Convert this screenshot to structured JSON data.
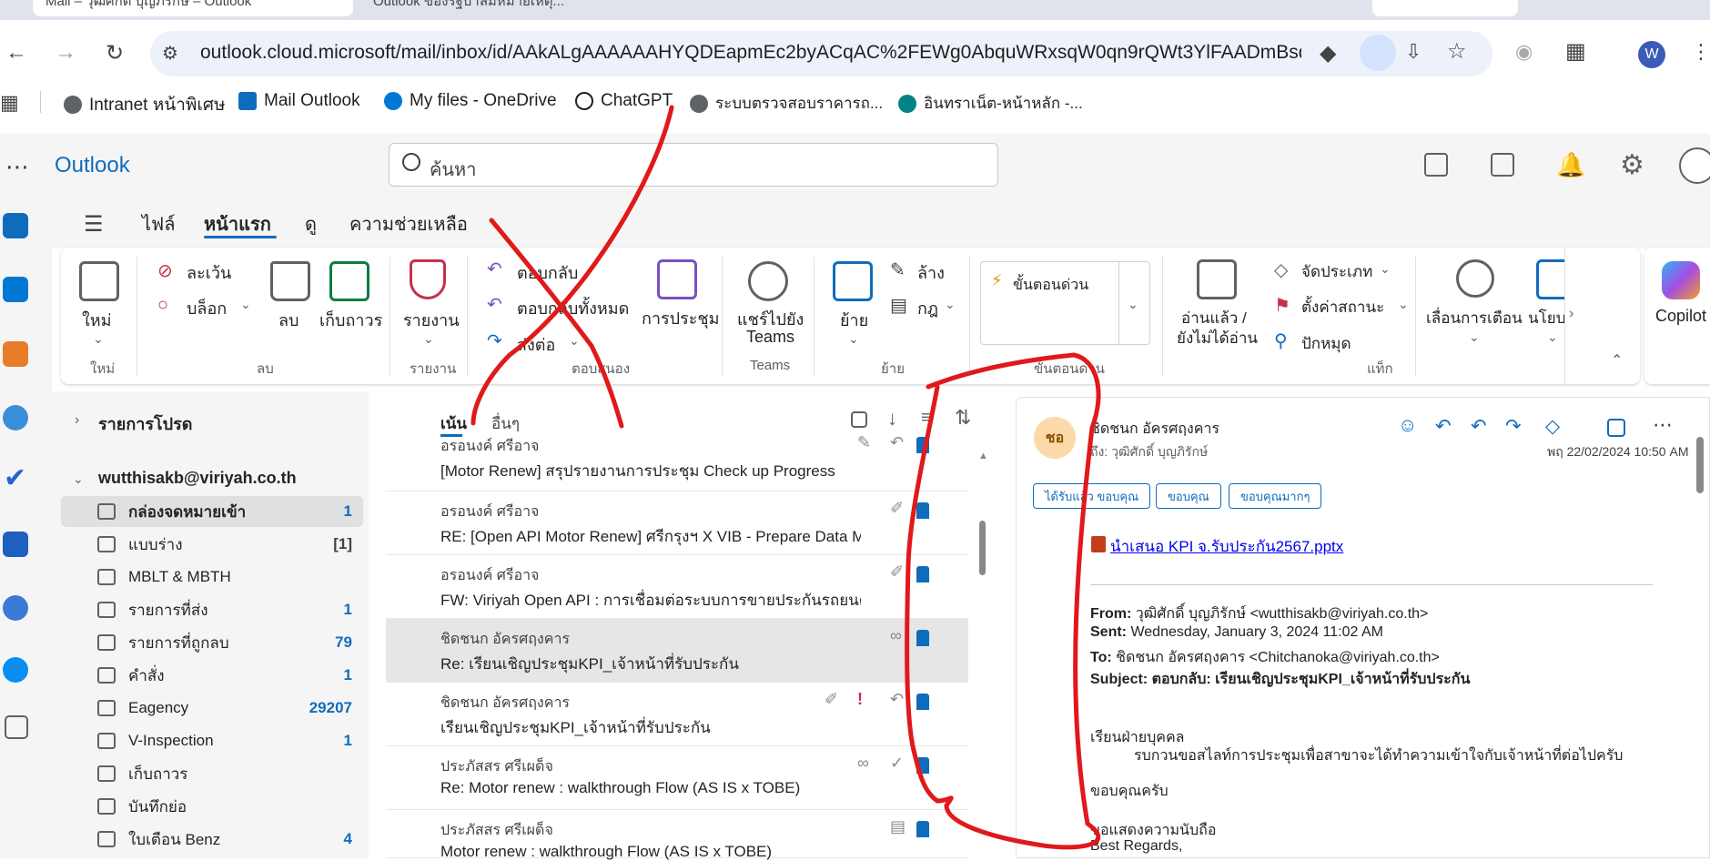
{
  "browser": {
    "tab1_title": "Mail – วุฒิศักดิ์ บุญภิรักษ์ – Outlook",
    "tab2_title": "Outlook ของรัฐบาลมีหมายเหตุ...",
    "url": "outlook.cloud.microsoft/mail/inbox/id/AAkALgAAAAAAHYQDEapmEc2byACqAC%2FEWg0AbquWRxsqW0qn9rQWt3YlFAADmBsq...",
    "profile_initial": "W",
    "bookmarks": [
      {
        "label": "Intranet หน้าพิเศษ",
        "color": "#5f6368"
      },
      {
        "label": "Mail Outlook",
        "color": "#0f6cbd"
      },
      {
        "label": "My files - OneDrive",
        "color": "#0078d4"
      },
      {
        "label": "ChatGPT",
        "color": "#1f1f1f"
      },
      {
        "label": "ระบบตรวจสอบราคารถ...",
        "color": "#5f6368"
      },
      {
        "label": "อินทราเน็ต-หน้าหลัก -...",
        "color": "#038387"
      }
    ]
  },
  "app": {
    "name": "Outlook",
    "search_placeholder": "ค้นหา"
  },
  "menu_tabs": [
    "ไฟล์",
    "หน้าแรก",
    "ดู",
    "ความช่วยเหลือ"
  ],
  "ribbon": {
    "new": "ใหม่",
    "new_group": "ใหม่",
    "ignore": "ละเว้น",
    "block": "บล็อก",
    "delete": "ลบ",
    "archive": "เก็บถาวร",
    "delete_group": "ลบ",
    "report": "รายงาน",
    "report_group": "รายงาน",
    "reply": "ตอบกลับ",
    "reply_all": "ตอบกลับทั้งหมด",
    "forward": "ส่งต่อ",
    "meeting": "การประชุม",
    "respond_group": "ตอบสนอง",
    "share_teams_1": "แชร์ไปยัง",
    "share_teams_2": "Teams",
    "teams_group": "Teams",
    "move": "ย้าย",
    "sweep": "ล้าง",
    "rules": "กฎ",
    "move_group": "ย้าย",
    "quick_steps": "ขั้นตอนด่วน",
    "quick_steps_group": "ขั้นตอนด่วน",
    "read_unread_1": "อ่านแล้ว /",
    "read_unread_2": "ยังไม่ได้อ่าน",
    "categorize": "จัดประเภท",
    "flag": "ตั้งค่าสถานะ",
    "pin": "ปักหมุด",
    "tags_group": "แท็ก",
    "snooze": "เลื่อนการเตือน",
    "policy": "นโยบ",
    "copilot": "Copilot"
  },
  "folders": {
    "favorites": "รายการโปรด",
    "account": "wutthisakb@viriyah.co.th",
    "items": [
      {
        "label": "กล่องจดหมายเข้า",
        "count": "1"
      },
      {
        "label": "แบบร่าง",
        "count": "[1]"
      },
      {
        "label": "MBLT & MBTH",
        "count": ""
      },
      {
        "label": "รายการที่ส่ง",
        "count": "1"
      },
      {
        "label": "รายการที่ถูกลบ",
        "count": "79"
      },
      {
        "label": "คำสั่ง",
        "count": "1"
      },
      {
        "label": "Eagency",
        "count": "29207"
      },
      {
        "label": "V-Inspection",
        "count": "1"
      },
      {
        "label": "เก็บถาวร",
        "count": ""
      },
      {
        "label": "บันทึกย่อ",
        "count": ""
      },
      {
        "label": "ใบเตือน Benz",
        "count": "4"
      }
    ]
  },
  "list": {
    "tab_focused": "เน้น",
    "tab_other": "อื่นๆ",
    "messages": [
      {
        "sender": "อรอนงค์ ศรีอาจ",
        "subject": "[Motor Renew] สรุปรายงานการประชุม Check up Progress"
      },
      {
        "sender": "อรอนงค์ ศรีอาจ",
        "subject": "RE: [Open API Motor Renew] ศรีกรุงฯ X VIB - Prepare Data M"
      },
      {
        "sender": "อรอนงค์ ศรีอาจ",
        "subject": "FW: Viriyah Open API : การเชื่อมต่อระบบการขายประกันรถยนต์ไฟ"
      },
      {
        "sender": "ชิดชนก อัครศฤงคาร",
        "subject": "Re: เรียนเชิญประชุมKPI_เจ้าหน้าที่รับประกัน"
      },
      {
        "sender": "ชิดชนก อัครศฤงคาร",
        "subject": "เรียนเชิญประชุมKPI_เจ้าหน้าที่รับประกัน"
      },
      {
        "sender": "ประภัสสร ศรีเผด็จ",
        "subject": "Re: Motor renew : walkthrough Flow (AS IS x TOBE)"
      },
      {
        "sender": "ประภัสสร ศรีเผด็จ",
        "subject": "Motor renew : walkthrough Flow (AS IS x TOBE)"
      }
    ]
  },
  "reading": {
    "avatar": "ชอ",
    "sender": "ชิดชนก อัครศฤงคาร",
    "to": "ถึง: วุฒิศักดิ์ บุญภิรักษ์",
    "date": "พฤ 22/02/2024 10:50 AM",
    "quick_replies": [
      "ได้รับแล้ว ขอบคุณ",
      "ขอบคุณ",
      "ขอบคุณมากๆ"
    ],
    "attachment": "นำเสนอ KPI จ.รับประกัน2567.pptx",
    "from_label": "From:",
    "from_value": "วุฒิศักดิ์ บุญภิรักษ์ <wutthisakb@viriyah.co.th>",
    "sent_label": "Sent:",
    "sent_value": "Wednesday, January 3, 2024 11:02 AM",
    "to_label": "To:",
    "to_value": "ชิดชนก อัครศฤงคาร <Chitchanoka@viriyah.co.th>",
    "subject_label": "Subject:",
    "subject_value": "ตอบกลับ: เรียนเชิญประชุมKPI_เจ้าหน้าที่รับประกัน",
    "line1": "เรียนฝ่ายบุคคล",
    "line2": "รบกวนขอสไลท์การประชุมเพื่อสาขาจะได้ทำความเข้าใจกับเจ้าหน้าที่ต่อไปครับ",
    "line3": "ขอบคุณครับ",
    "line4": "ขอแสดงความนับถือ",
    "line5": "Best Regards,"
  },
  "colors": {
    "brand": "#0f6cbd",
    "annotation": "#e0191b"
  }
}
